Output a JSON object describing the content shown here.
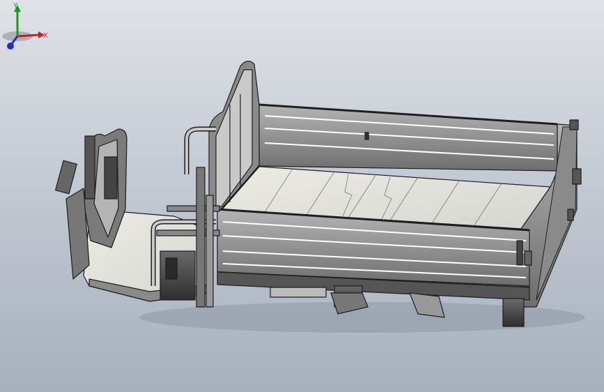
{
  "viewport": {
    "background_top": "#dfe2e6",
    "background_bottom": "#a7b0bd",
    "model_edge_color": "#1e1e22",
    "model_face_color": "#9a9a9a",
    "bed_floor_color": "#e4e4e0"
  },
  "triad": {
    "x_label": "X",
    "y_label": "Y",
    "x_color": "#d11a1a",
    "y_color": "#1a9a1a",
    "z_color": "#1a2fd1"
  }
}
